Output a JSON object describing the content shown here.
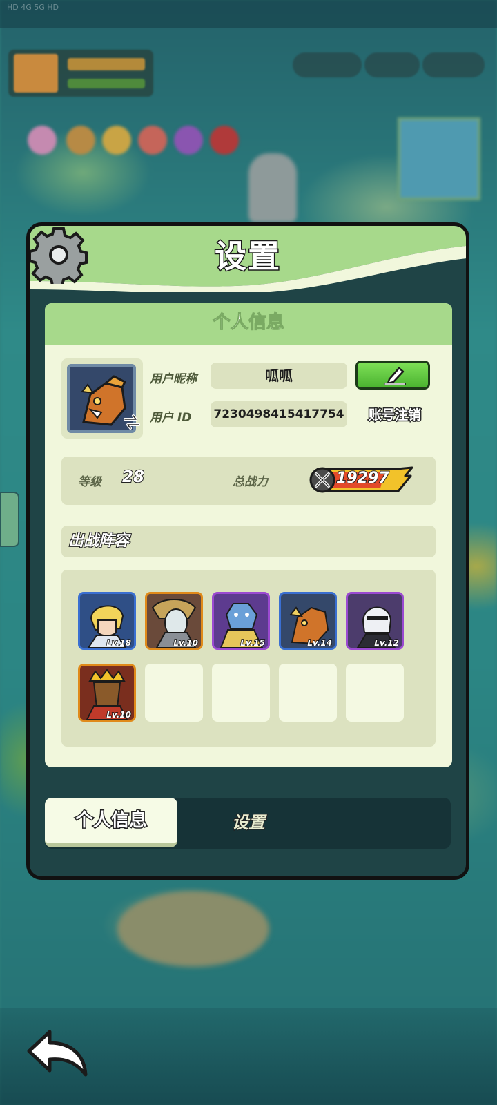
{
  "status_bar_text": "HD 4G 5G HD",
  "panel": {
    "title": "设置"
  },
  "personal_info": {
    "section_title": "个人信息",
    "nickname_label": "用户昵称",
    "nickname_value": "呱呱",
    "id_label": "用户   ID",
    "id_value": "7230498415417754",
    "cancel_account_label": "账号注销"
  },
  "stats": {
    "level_label": "等级",
    "level_value": "28",
    "power_label": "总战力",
    "power_value": "19297"
  },
  "lineup": {
    "title": "出战阵容",
    "heroes": [
      {
        "level": "Lv.18",
        "rarity_color": "#3a6fd1",
        "icon": "hero-blonde-knight-icon"
      },
      {
        "level": "Lv.10",
        "rarity_color": "#e08a1a",
        "icon": "hero-pale-ghost-icon"
      },
      {
        "level": "Lv.15",
        "rarity_color": "#9b4ad1",
        "icon": "hero-blue-beast-icon"
      },
      {
        "level": "Lv.14",
        "rarity_color": "#3a6fd1",
        "icon": "hero-orange-dragon-icon"
      },
      {
        "level": "Lv.12",
        "rarity_color": "#9b4ad1",
        "icon": "hero-white-hair-android-icon"
      },
      {
        "level": "Lv.10",
        "rarity_color": "#e08a1a",
        "icon": "hero-crowned-king-icon"
      }
    ],
    "empty_slots": 4
  },
  "tabs": {
    "active": "个人信息",
    "inactive": "设置"
  },
  "colors": {
    "panel_green": "#a7d98b",
    "edit_green": "#4bb330",
    "content_bg": "#f1f7dc"
  }
}
